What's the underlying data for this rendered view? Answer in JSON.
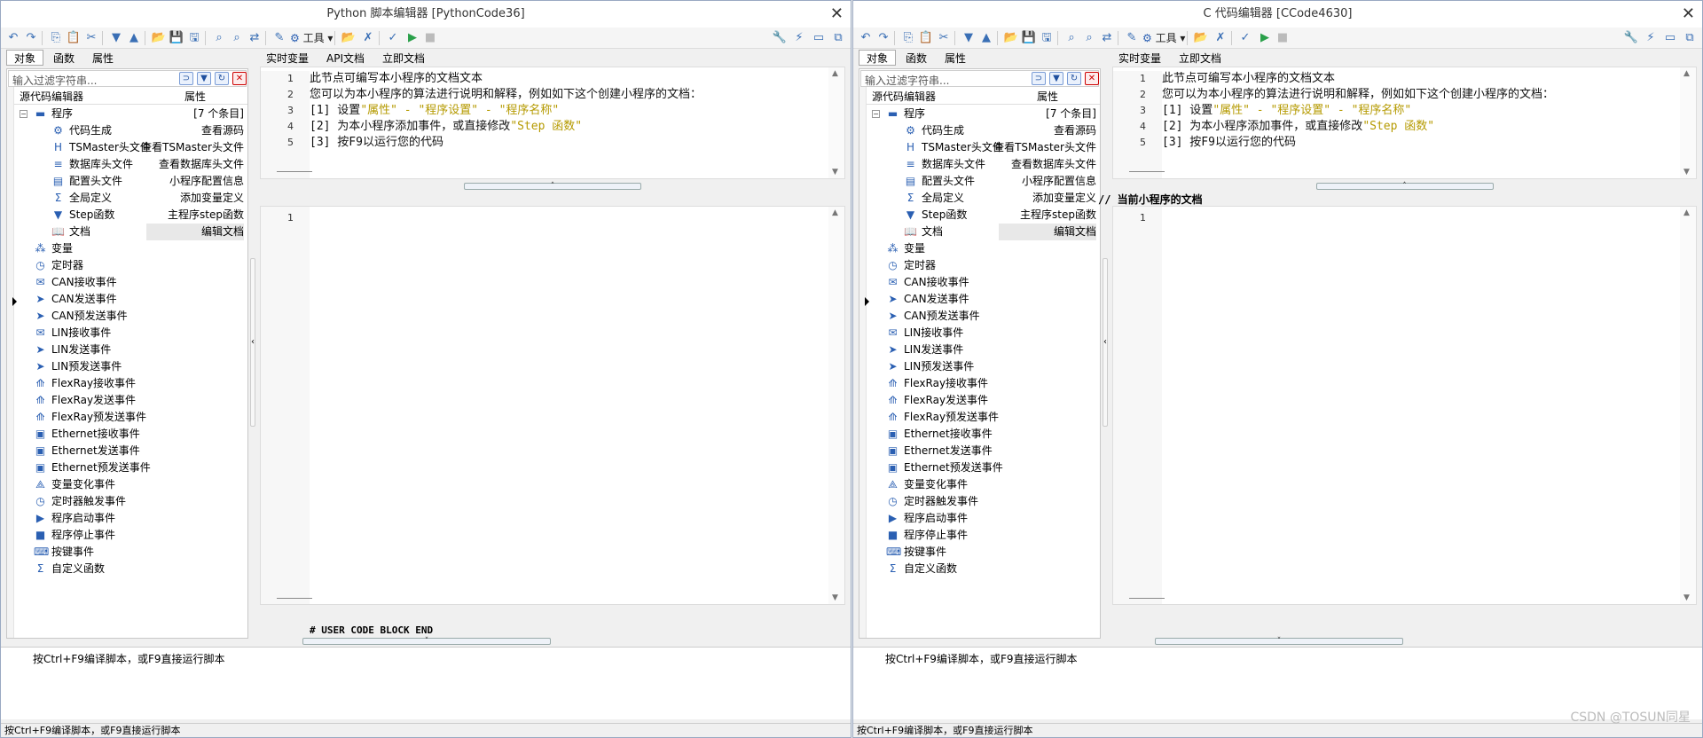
{
  "watermark": "CSDN @TOSUN同星",
  "left_window": {
    "title": "Python 脚本编辑器 [PythonCode36]",
    "tools_label": "工具",
    "left_tabs": [
      "对象",
      "函数",
      "属性"
    ],
    "filter_placeholder": "输入过滤字符串...",
    "tree_header": {
      "col1": "源代码编辑器",
      "col2": "属性"
    },
    "program": {
      "label": "程序",
      "value": "[7 个条目]"
    },
    "program_children": [
      {
        "label": "代码生成",
        "value": "查看源码",
        "icon": "codegen-icon"
      },
      {
        "label": "TSMaster头文件",
        "value": "查看TSMaster头文件",
        "icon": "header-h-icon"
      },
      {
        "label": "数据库头文件",
        "value": "查看数据库头文件",
        "icon": "database-icon"
      },
      {
        "label": "配置头文件",
        "value": "小程序配置信息",
        "icon": "config-icon"
      },
      {
        "label": "全局定义",
        "value": "添加变量定义",
        "icon": "global-def-icon"
      },
      {
        "label": "Step函数",
        "value": "主程序step函数",
        "icon": "step-triangle-icon"
      },
      {
        "label": "文档",
        "value": "编辑文档",
        "icon": "book-icon"
      }
    ],
    "events": [
      {
        "label": "变量",
        "icon": "variable-icon"
      },
      {
        "label": "定时器",
        "icon": "timer-icon"
      },
      {
        "label": "CAN接收事件",
        "icon": "envelope-icon"
      },
      {
        "label": "CAN发送事件",
        "icon": "send-icon"
      },
      {
        "label": "CAN预发送事件",
        "icon": "send-icon"
      },
      {
        "label": "LIN接收事件",
        "icon": "envelope-icon"
      },
      {
        "label": "LIN发送事件",
        "icon": "send-icon"
      },
      {
        "label": "LIN预发送事件",
        "icon": "send-icon"
      },
      {
        "label": "FlexRay接收事件",
        "icon": "flexray-icon"
      },
      {
        "label": "FlexRay发送事件",
        "icon": "flexray-icon"
      },
      {
        "label": "FlexRay预发送事件",
        "icon": "flexray-icon"
      },
      {
        "label": "Ethernet接收事件",
        "icon": "ethernet-icon"
      },
      {
        "label": "Ethernet发送事件",
        "icon": "ethernet-icon"
      },
      {
        "label": "Ethernet预发送事件",
        "icon": "ethernet-icon"
      },
      {
        "label": "变量变化事件",
        "icon": "var-change-icon"
      },
      {
        "label": "定时器触发事件",
        "icon": "timer-icon"
      },
      {
        "label": "程序启动事件",
        "icon": "play-icon"
      },
      {
        "label": "程序停止事件",
        "icon": "stop-icon"
      },
      {
        "label": "按键事件",
        "icon": "keyboard-icon"
      },
      {
        "label": "自定义函数",
        "icon": "sigma-icon"
      }
    ],
    "right_tabs": [
      "实时变量",
      "API文档",
      "立即文档"
    ],
    "doc_lines": [
      {
        "num": "1",
        "text": "此节点可编写本小程序的文档文本"
      },
      {
        "num": "2",
        "text": "您可以为本小程序的算法进行说明和解释，例如如下这个创建小程序的文档："
      },
      {
        "num": "3",
        "pre": "[1] 设置",
        "s1": "\"属性\" - \"程序设置\" - \"程序名称\"",
        "post": ""
      },
      {
        "num": "4",
        "pre": "[2] 为本小程序添加事件，或直接修改",
        "s1": "\"Step 函数\"",
        "post": ""
      },
      {
        "num": "5",
        "text": "[3] 按F9以运行您的代码"
      }
    ],
    "editor_line": "1",
    "block_end": "# USER CODE BLOCK END",
    "output_msg": "按Ctrl+F9编译脚本，或F9直接运行脚本",
    "status": "按Ctrl+F9编译脚本，或F9直接运行脚本"
  },
  "right_window": {
    "title": "C 代码编辑器 [CCode4630]",
    "tools_label": "工具",
    "left_tabs": [
      "对象",
      "函数",
      "属性"
    ],
    "filter_placeholder": "输入过滤字符串...",
    "tree_header": {
      "col1": "源代码编辑器",
      "col2": "属性"
    },
    "program": {
      "label": "程序",
      "value": "[7 个条目]"
    },
    "program_children": [
      {
        "label": "代码生成",
        "value": "查看源码",
        "icon": "codegen-icon"
      },
      {
        "label": "TSMaster头文件",
        "value": "查看TSMaster头文件",
        "icon": "header-h-icon"
      },
      {
        "label": "数据库头文件",
        "value": "查看数据库头文件",
        "icon": "database-icon"
      },
      {
        "label": "配置头文件",
        "value": "小程序配置信息",
        "icon": "config-icon"
      },
      {
        "label": "全局定义",
        "value": "添加变量定义",
        "icon": "global-def-icon"
      },
      {
        "label": "Step函数",
        "value": "主程序step函数",
        "icon": "step-triangle-icon"
      },
      {
        "label": "文档",
        "value": "编辑文档",
        "icon": "book-icon"
      }
    ],
    "events": [
      {
        "label": "变量",
        "icon": "variable-icon"
      },
      {
        "label": "定时器",
        "icon": "timer-icon"
      },
      {
        "label": "CAN接收事件",
        "icon": "envelope-icon"
      },
      {
        "label": "CAN发送事件",
        "icon": "send-icon"
      },
      {
        "label": "CAN预发送事件",
        "icon": "send-icon"
      },
      {
        "label": "LIN接收事件",
        "icon": "envelope-icon"
      },
      {
        "label": "LIN发送事件",
        "icon": "send-icon"
      },
      {
        "label": "LIN预发送事件",
        "icon": "send-icon"
      },
      {
        "label": "FlexRay接收事件",
        "icon": "flexray-icon"
      },
      {
        "label": "FlexRay发送事件",
        "icon": "flexray-icon"
      },
      {
        "label": "FlexRay预发送事件",
        "icon": "flexray-icon"
      },
      {
        "label": "Ethernet接收事件",
        "icon": "ethernet-icon"
      },
      {
        "label": "Ethernet发送事件",
        "icon": "ethernet-icon"
      },
      {
        "label": "Ethernet预发送事件",
        "icon": "ethernet-icon"
      },
      {
        "label": "变量变化事件",
        "icon": "var-change-icon"
      },
      {
        "label": "定时器触发事件",
        "icon": "timer-icon"
      },
      {
        "label": "程序启动事件",
        "icon": "play-icon"
      },
      {
        "label": "程序停止事件",
        "icon": "stop-icon"
      },
      {
        "label": "按键事件",
        "icon": "keyboard-icon"
      },
      {
        "label": "自定义函数",
        "icon": "sigma-icon"
      }
    ],
    "right_tabs": [
      "实时变量",
      "立即文档"
    ],
    "doc_lines": [
      {
        "num": "1",
        "text": "此节点可编写本小程序的文档文本"
      },
      {
        "num": "2",
        "text": "您可以为本小程序的算法进行说明和解释，例如如下这个创建小程序的文档："
      },
      {
        "num": "3",
        "pre": "[1] 设置",
        "s1": "\"属性\" - \"程序设置\" - \"程序名称\"",
        "post": ""
      },
      {
        "num": "4",
        "pre": "[2] 为本小程序添加事件，或直接修改",
        "s1": "\"Step 函数\"",
        "post": ""
      },
      {
        "num": "5",
        "text": "[3] 按F9以运行您的代码"
      }
    ],
    "doc_heading": "// 当前小程序的文档",
    "editor_line": "1",
    "output_msg": "按Ctrl+F9编译脚本，或F9直接运行脚本",
    "status": "按Ctrl+F9编译脚本，或F9直接运行脚本"
  }
}
